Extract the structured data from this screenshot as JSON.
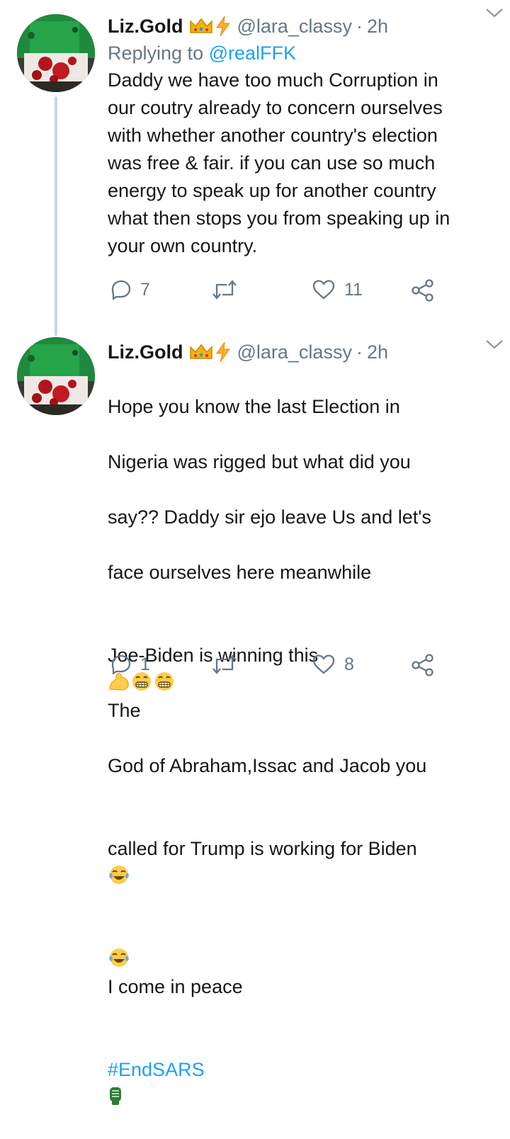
{
  "thread": [
    {
      "author_name": "Liz.Gold",
      "handle": "@lara_classy",
      "separator": "·",
      "time": "2h",
      "replying_prefix": "Replying to",
      "replying_to": "@realFFK",
      "text": "Daddy we have too much Corruption in\nour coutry already to concern ourselves\nwith whether another country's election\nwas free & fair. if you can use so much\nenergy to speak up for another country\nwhat then stops you from speaking up in\nyour own country.",
      "reply_count": "7",
      "retweet_count": "",
      "like_count": "11"
    },
    {
      "author_name": "Liz.Gold",
      "handle": "@lara_classy",
      "separator": "·",
      "time": "2h",
      "text_lines": [
        "Hope you know the last Election in",
        "Nigeria was rigged but what did you",
        "say?? Daddy sir ejo leave Us and let's",
        "face ourselves here meanwhile",
        "Joe-Biden is winning this",
        "The",
        "God of Abraham,Issac and Jacob you",
        "called for Trump is working for Biden",
        "I come in peace"
      ],
      "hashtag": "#EndSARS",
      "reply_count": "1",
      "retweet_count": "",
      "like_count": "8"
    }
  ],
  "icons": {
    "badge_1": "crown-emoji",
    "badge_2": "lightning-emoji",
    "caret": "chevron-down-icon",
    "reply": "reply-icon",
    "retweet": "retweet-icon",
    "like": "heart-icon",
    "share": "share-icon"
  },
  "colors": {
    "link": "#1da1f2",
    "secondary_text": "#657786",
    "primary_text": "#14171a",
    "thread_line": "#ccd6dd"
  }
}
